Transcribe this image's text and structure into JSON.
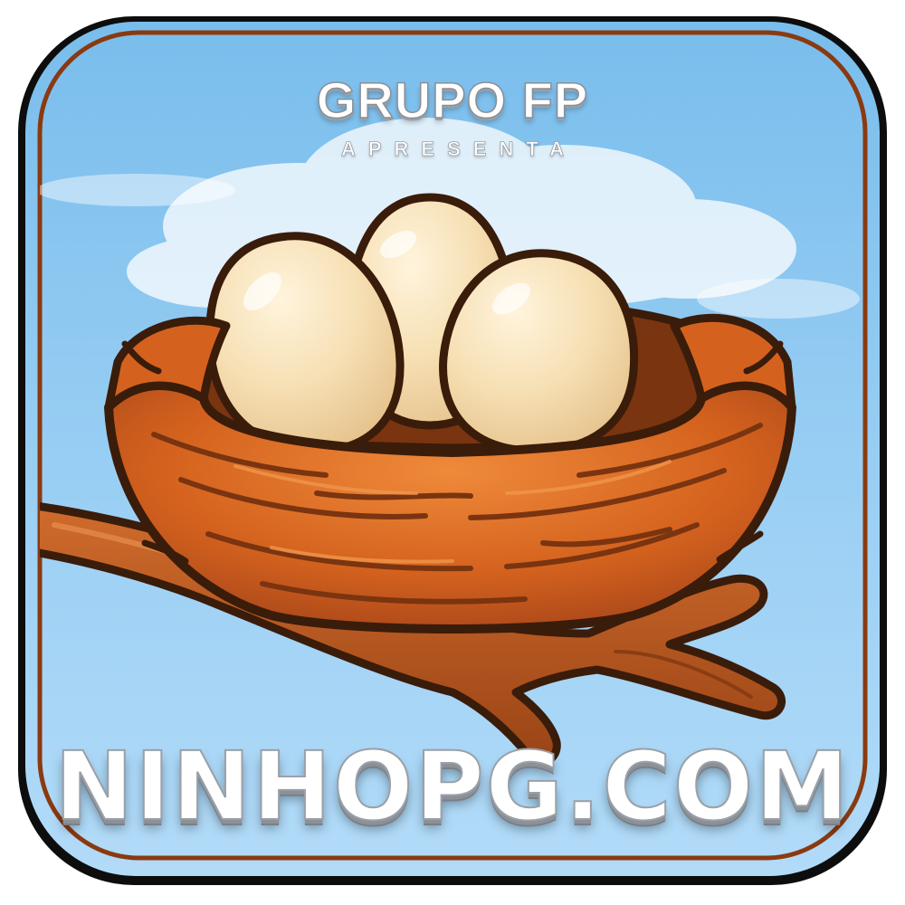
{
  "brand": {
    "title": "GRUPO FP",
    "subtitle": "APRESENTA"
  },
  "site": {
    "domain": "NINHOPG.COM"
  },
  "illustration": {
    "subject": "nest-with-three-eggs",
    "egg_count": 3
  },
  "colors": {
    "sky_top": "#7ec0ee",
    "sky_bottom": "#aad6f7",
    "border_brown": "#8a3a10",
    "nest_orange": "#d9661f",
    "nest_dark": "#8a3a10",
    "egg_cream": "#f5dfb5",
    "branch_brown": "#b8541c",
    "outline": "#3a1c0a"
  }
}
